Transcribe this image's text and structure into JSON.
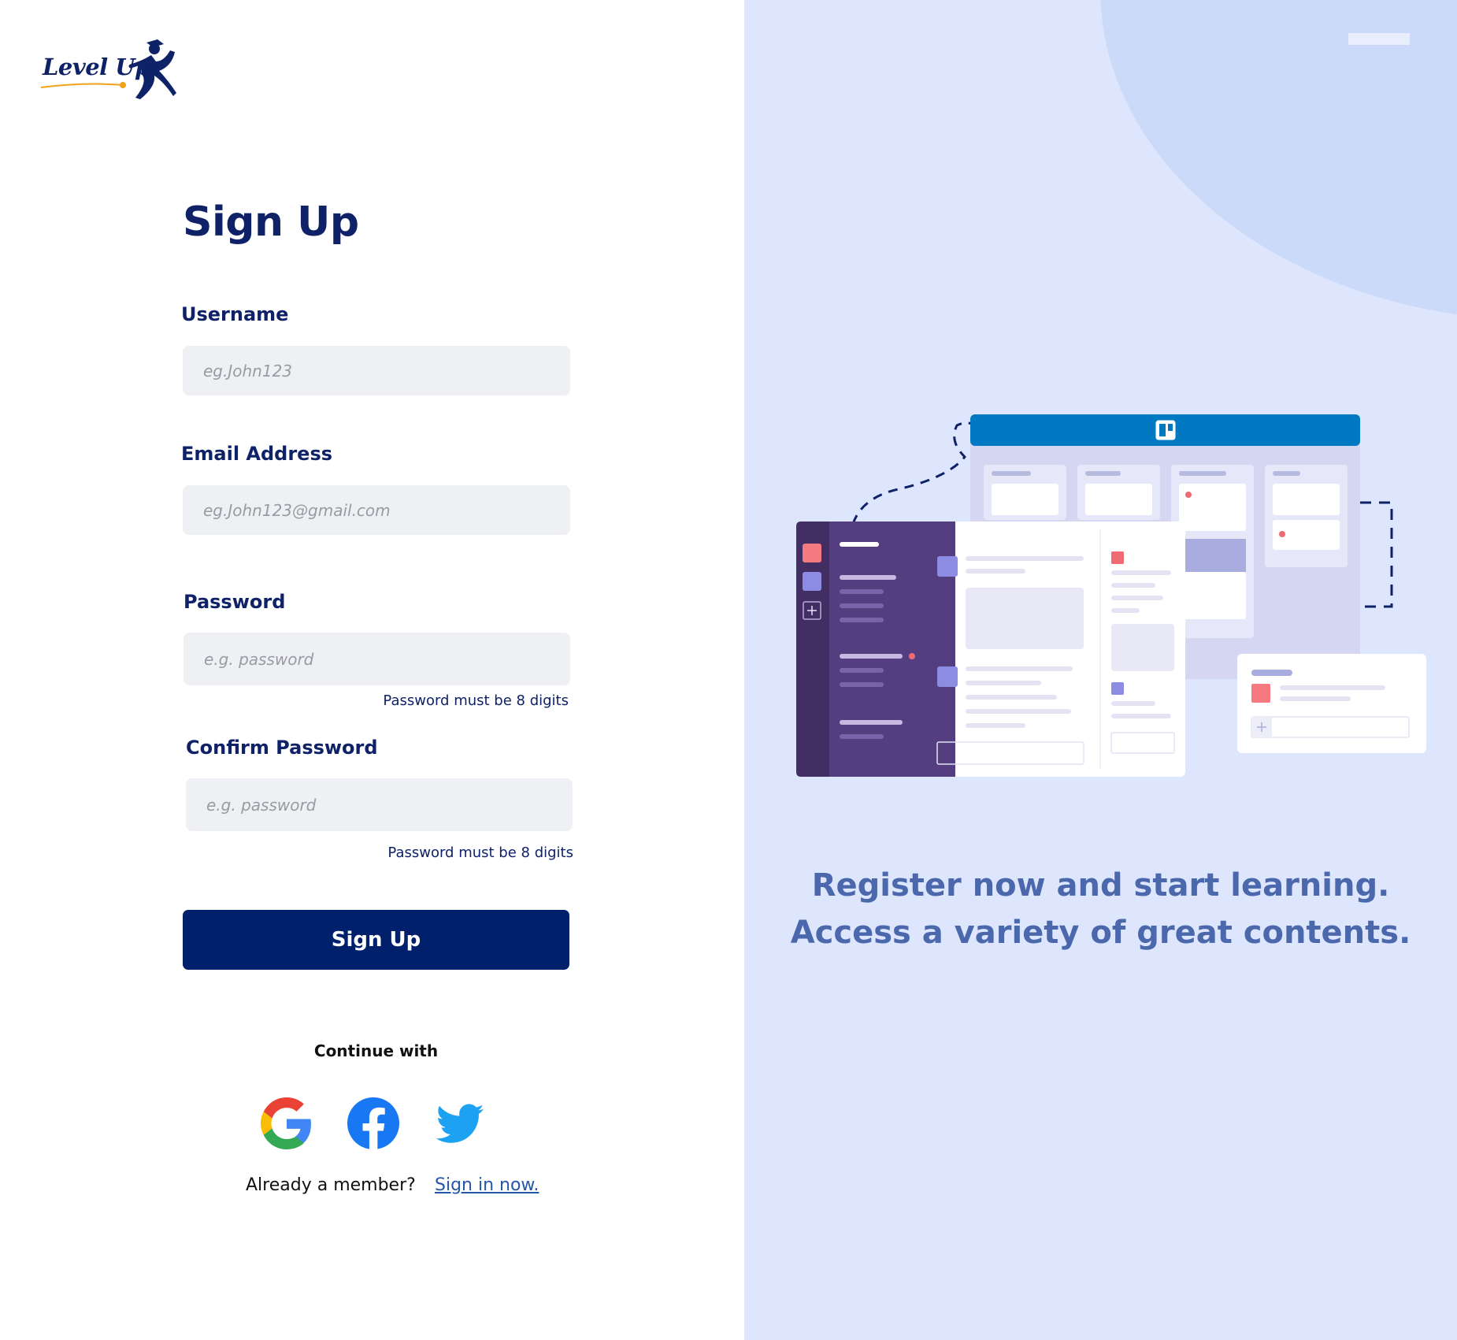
{
  "brand": {
    "name": "Level Up"
  },
  "form": {
    "title": "Sign Up",
    "username": {
      "label": "Username",
      "placeholder": "eg.John123"
    },
    "email": {
      "label": "Email Address",
      "placeholder": "eg.John123@gmail.com"
    },
    "password": {
      "label": "Password",
      "placeholder": "e.g. password",
      "hint": "Password must be 8 digits"
    },
    "confirm_password": {
      "label": "Confirm Password",
      "placeholder": "e.g. password",
      "hint": "Password must be 8 digits"
    },
    "submit_label": "Sign Up",
    "continue_with": "Continue with",
    "social": [
      "google-icon",
      "facebook-icon",
      "twitter-icon"
    ],
    "member_text": "Already a member?",
    "signin_link": "Sign in now."
  },
  "promo": {
    "line1": "Register now and start learning.",
    "line2": "Access a variety of great contents."
  },
  "colors": {
    "primary": "#00206b",
    "panel_bg": "#dde6fd",
    "input_bg": "#eff0f4",
    "tagline": "#4a68ab",
    "link": "#2557a7"
  }
}
